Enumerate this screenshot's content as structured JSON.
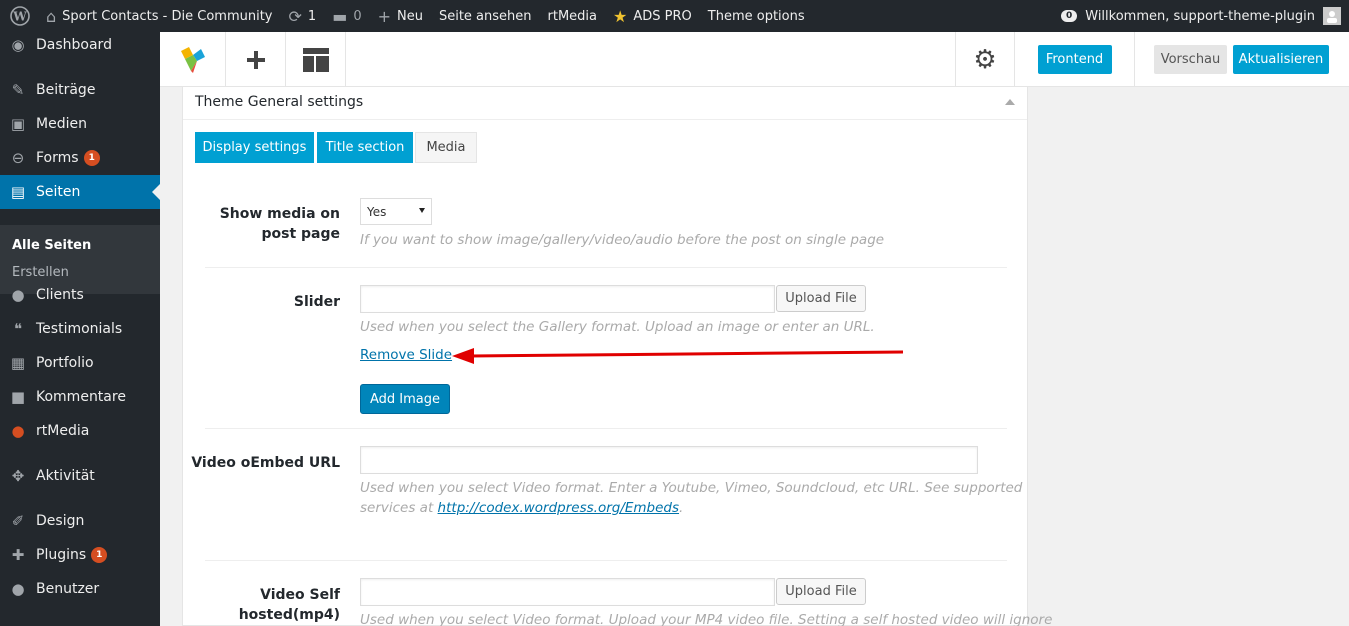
{
  "admin_bar": {
    "site_name": "Sport Contacts - Die Community",
    "updates_count": "1",
    "comments_count": "0",
    "new_label": "Neu",
    "view_page": "Seite ansehen",
    "rtmedia": "rtMedia",
    "ads_pro": "ADS PRO",
    "theme_options": "Theme options",
    "notifications_count": "0",
    "greeting": "Willkommen, support-theme-plugin"
  },
  "sidebar": {
    "items": [
      {
        "label": "Dashboard",
        "icon": "dashboard-icon",
        "glyph": "◉"
      },
      {
        "label": "Beiträge",
        "icon": "pin-icon",
        "glyph": "✎"
      },
      {
        "label": "Medien",
        "icon": "media-icon",
        "glyph": "▣"
      },
      {
        "label": "Forms",
        "icon": "forms-icon",
        "glyph": "⊖",
        "badge": "1"
      },
      {
        "label": "Seiten",
        "icon": "pages-icon",
        "glyph": "▤"
      },
      {
        "label": "Clients",
        "icon": "user-icon",
        "glyph": "●"
      },
      {
        "label": "Testimonials",
        "icon": "quote-icon",
        "glyph": "❝"
      },
      {
        "label": "Portfolio",
        "icon": "portfolio-icon",
        "glyph": "▦"
      },
      {
        "label": "Kommentare",
        "icon": "comment-icon",
        "glyph": "■"
      },
      {
        "label": "rtMedia",
        "icon": "rtmedia-icon",
        "glyph": "●"
      },
      {
        "label": "Aktivität",
        "icon": "activity-icon",
        "glyph": "✥"
      },
      {
        "label": "Design",
        "icon": "brush-icon",
        "glyph": "✐"
      },
      {
        "label": "Plugins",
        "icon": "plugin-icon",
        "glyph": "✚",
        "badge": "1"
      },
      {
        "label": "Benutzer",
        "icon": "users-icon",
        "glyph": "●"
      }
    ],
    "submenu": [
      "Alle Seiten",
      "Erstellen"
    ]
  },
  "toolbar": {
    "frontend": "Frontend",
    "preview": "Vorschau",
    "update": "Aktualisieren"
  },
  "panel": {
    "title": "Theme General settings",
    "tabs": [
      "Display settings",
      "Title section",
      "Media"
    ],
    "show_media": {
      "label_line1": "Show media on",
      "label_line2": "post page",
      "value": "Yes",
      "desc": "If you want to show image/gallery/video/audio before the post on single page"
    },
    "slider": {
      "label": "Slider",
      "upload": "Upload File",
      "desc": "Used when you select the Gallery format. Upload an image or enter an URL.",
      "remove": "Remove Slide",
      "add": "Add Image"
    },
    "video_embed": {
      "label": "Video oEmbed URL",
      "desc_line1": "Used when you select Video format. Enter a Youtube, Vimeo, Soundcloud, etc URL. See supported",
      "desc_line2_prefix": "services at ",
      "desc_link": "http://codex.wordpress.org/Embeds",
      "desc_line2_suffix": "."
    },
    "video_self": {
      "label_line1": "Video Self",
      "label_line2": "hosted(mp4)",
      "upload": "Upload File",
      "desc": "Used when you select Video format. Upload your MP4 video file. Setting a self hosted video will ignore"
    }
  },
  "colors": {
    "admin_bg": "#23282d",
    "accent": "#00a0d2",
    "current_menu": "#0073aa",
    "badge": "#d54e21",
    "arrow": "#e00000"
  }
}
